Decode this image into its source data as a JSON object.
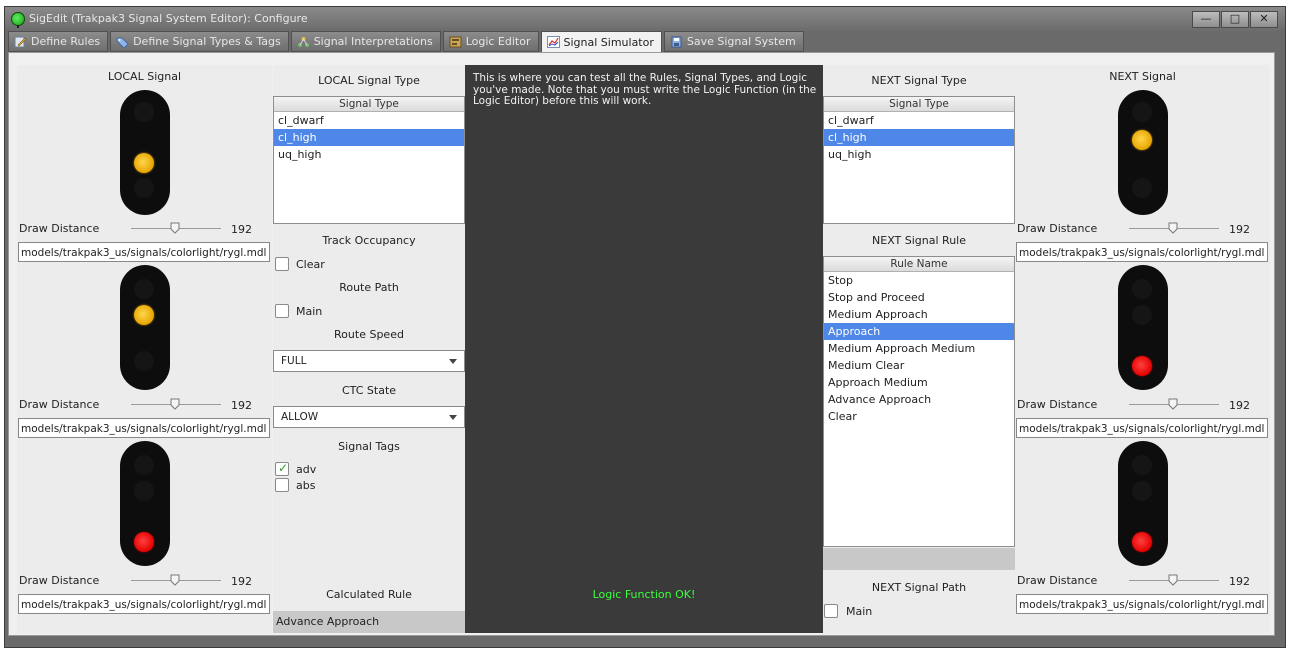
{
  "window": {
    "title": "SigEdit (Trakpak3 Signal System Editor): Configure",
    "controls": {
      "minimize": "—",
      "maximize": "□",
      "close": "✕"
    }
  },
  "tabs": [
    {
      "label": "Define Rules",
      "icon": "edit-icon",
      "active": false
    },
    {
      "label": "Define Signal Types & Tags",
      "icon": "tag-icon",
      "active": false
    },
    {
      "label": "Signal Interpretations",
      "icon": "flow-icon",
      "active": false
    },
    {
      "label": "Logic Editor",
      "icon": "logic-icon",
      "active": false
    },
    {
      "label": "Signal Simulator",
      "icon": "chart-icon",
      "active": true
    },
    {
      "label": "Save Signal System",
      "icon": "save-icon",
      "active": false
    }
  ],
  "local_signal": {
    "title": "LOCAL Signal",
    "heads": [
      {
        "draw_distance_label": "Draw Distance",
        "draw_distance": "192",
        "model": "models/trakpak3_us/signals/colorlight/rygl.mdl",
        "lit": "yellow"
      },
      {
        "draw_distance_label": "Draw Distance",
        "draw_distance": "192",
        "model": "models/trakpak3_us/signals/colorlight/rygl.mdl",
        "lit": "yellow"
      },
      {
        "draw_distance_label": "Draw Distance",
        "draw_distance": "192",
        "model": "models/trakpak3_us/signals/colorlight/rygl.mdl",
        "lit": "red"
      }
    ]
  },
  "local_type": {
    "title": "LOCAL Signal Type",
    "list_header": "Signal Type",
    "items": [
      "cl_dwarf",
      "cl_high",
      "uq_high"
    ],
    "selected_index": 1
  },
  "track_occupancy": {
    "title": "Track Occupancy",
    "clear_label": "Clear",
    "clear_checked": false
  },
  "route_path": {
    "title": "Route Path",
    "main_label": "Main",
    "main_checked": false
  },
  "route_speed": {
    "title": "Route Speed",
    "value": "FULL"
  },
  "ctc_state": {
    "title": "CTC State",
    "value": "ALLOW"
  },
  "signal_tags": {
    "title": "Signal Tags",
    "tags": [
      {
        "label": "adv",
        "checked": true
      },
      {
        "label": "abs",
        "checked": false
      }
    ]
  },
  "calculated_rule": {
    "title": "Calculated Rule",
    "value": "Advance Approach"
  },
  "console": {
    "message": "This is where you can test all the Rules, Signal Types, and Logic you've made. Note that you must write the Logic Function (in the Logic Editor) before this will work.",
    "status": "Logic Function OK!",
    "status_color": "#3cff3c"
  },
  "next_type": {
    "title": "NEXT Signal Type",
    "list_header": "Signal Type",
    "items": [
      "cl_dwarf",
      "cl_high",
      "uq_high"
    ],
    "selected_index": 1
  },
  "next_rule": {
    "title": "NEXT Signal Rule",
    "list_header": "Rule Name",
    "items": [
      "Stop",
      "Stop and Proceed",
      "Medium Approach",
      "Approach",
      "Medium Approach Medium",
      "Medium Clear",
      "Approach Medium",
      "Advance Approach",
      "Clear"
    ],
    "selected_index": 3
  },
  "next_path": {
    "title": "NEXT Signal Path",
    "main_label": "Main",
    "main_checked": false
  },
  "next_signal": {
    "title": "NEXT Signal",
    "heads": [
      {
        "draw_distance_label": "Draw Distance",
        "draw_distance": "192",
        "model": "models/trakpak3_us/signals/colorlight/rygl.mdl",
        "lit": "yellow"
      },
      {
        "draw_distance_label": "Draw Distance",
        "draw_distance": "192",
        "model": "models/trakpak3_us/signals/colorlight/rygl.mdl",
        "lit": "red"
      },
      {
        "draw_distance_label": "Draw Distance",
        "draw_distance": "192",
        "model": "models/trakpak3_us/signals/colorlight/rygl.mdl",
        "lit": "red"
      }
    ]
  },
  "colors": {
    "selection": "#4f87e8",
    "console_bg": "#3a3a3a",
    "lamp_yellow": "#f2b800",
    "lamp_red": "#ff1a1a"
  }
}
